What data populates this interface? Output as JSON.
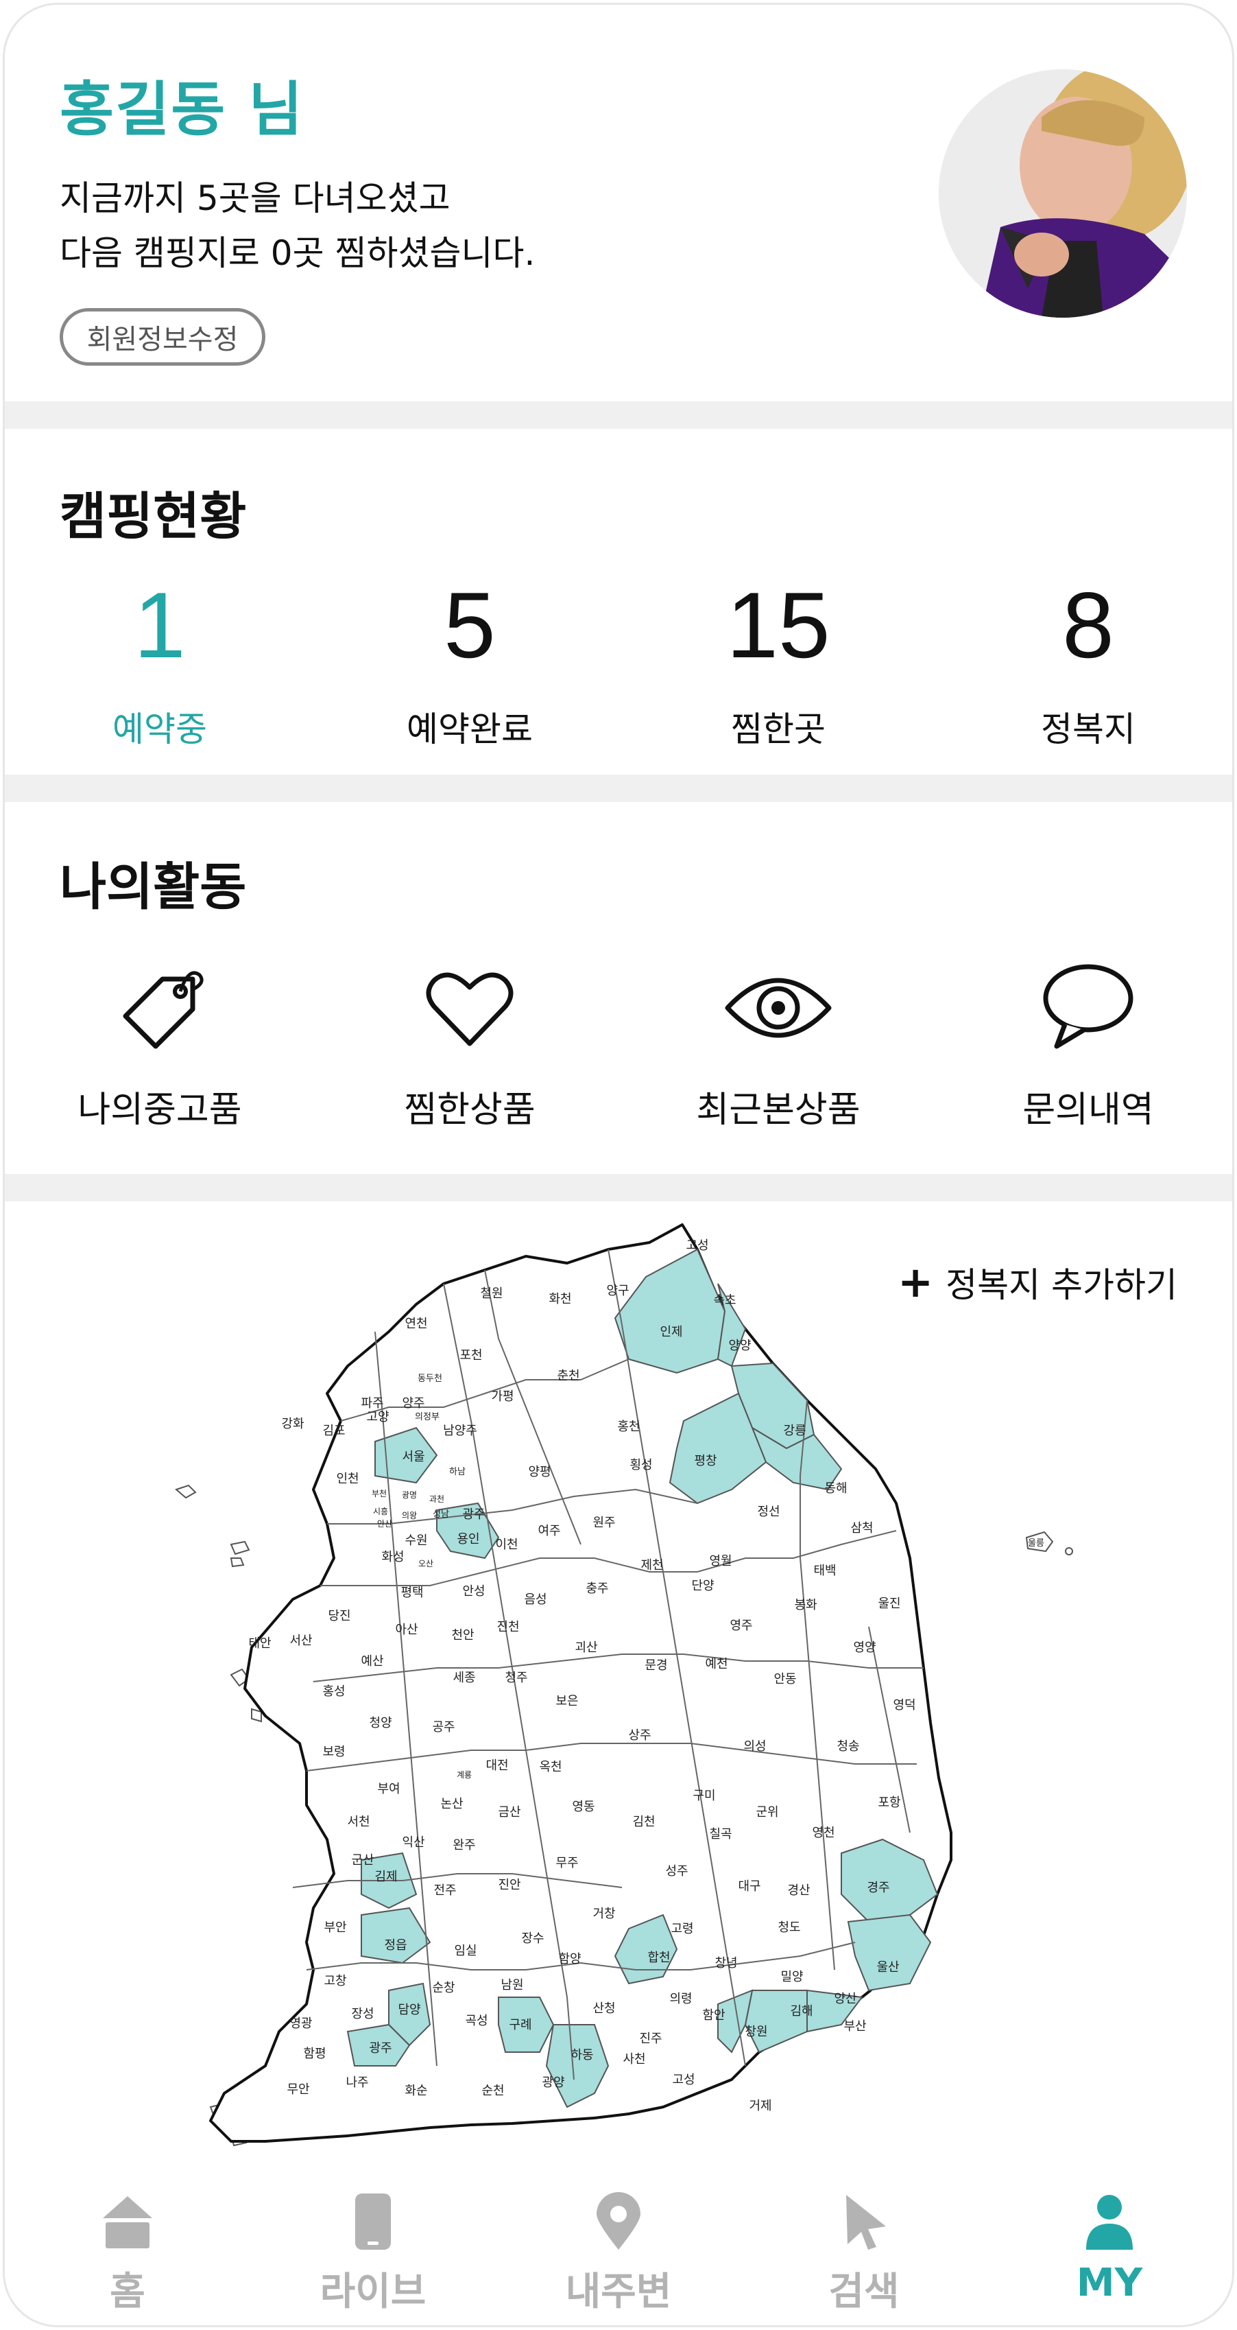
{
  "profile": {
    "name": "홍길동 님",
    "line1": "지금까지 5곳을 다녀오셨고",
    "line2": "다음 캠핑지로 0곳 찜하셨습니다.",
    "edit_button": "회원정보수정"
  },
  "camping_status": {
    "title": "캠핑현황",
    "stats": [
      {
        "value": "1",
        "label": "예약중",
        "active": true
      },
      {
        "value": "5",
        "label": "예약완료",
        "active": false
      },
      {
        "value": "15",
        "label": "찜한곳",
        "active": false
      },
      {
        "value": "8",
        "label": "정복지",
        "active": false
      }
    ]
  },
  "my_activity": {
    "title": "나의활동",
    "items": [
      {
        "label": "나의중고품",
        "icon": "tag-icon"
      },
      {
        "label": "찜한상품",
        "icon": "heart-icon"
      },
      {
        "label": "최근본상품",
        "icon": "eye-icon"
      },
      {
        "label": "문의내역",
        "icon": "chat-bubble-icon"
      }
    ]
  },
  "map": {
    "add_label": "정복지 추가하기",
    "highlight_color": "#a8dedc",
    "regions": [
      {
        "name": "고성",
        "visited": false
      },
      {
        "name": "속초",
        "visited": true
      },
      {
        "name": "인제",
        "visited": true
      },
      {
        "name": "양양",
        "visited": true
      },
      {
        "name": "철원",
        "visited": false
      },
      {
        "name": "화천",
        "visited": false
      },
      {
        "name": "양구",
        "visited": false
      },
      {
        "name": "연천",
        "visited": false
      },
      {
        "name": "포천",
        "visited": false
      },
      {
        "name": "춘천",
        "visited": false
      },
      {
        "name": "동두천",
        "visited": false
      },
      {
        "name": "가평",
        "visited": false
      },
      {
        "name": "파주",
        "visited": false
      },
      {
        "name": "양주",
        "visited": false
      },
      {
        "name": "홍천",
        "visited": false
      },
      {
        "name": "강릉",
        "visited": true
      },
      {
        "name": "강화",
        "visited": false
      },
      {
        "name": "김포",
        "visited": false
      },
      {
        "name": "고양",
        "visited": false
      },
      {
        "name": "의정부",
        "visited": false
      },
      {
        "name": "남양주",
        "visited": false
      },
      {
        "name": "서울",
        "visited": true
      },
      {
        "name": "하남",
        "visited": false
      },
      {
        "name": "양평",
        "visited": false
      },
      {
        "name": "횡성",
        "visited": false
      },
      {
        "name": "평창",
        "visited": true
      },
      {
        "name": "동해",
        "visited": true
      },
      {
        "name": "인천",
        "visited": false
      },
      {
        "name": "부천",
        "visited": false
      },
      {
        "name": "광명",
        "visited": false
      },
      {
        "name": "과천",
        "visited": false
      },
      {
        "name": "성남",
        "visited": false
      },
      {
        "name": "광주",
        "visited": false
      },
      {
        "name": "시흥",
        "visited": false
      },
      {
        "name": "안산",
        "visited": false
      },
      {
        "name": "의왕",
        "visited": false
      },
      {
        "name": "수원",
        "visited": false
      },
      {
        "name": "용인",
        "visited": true
      },
      {
        "name": "이천",
        "visited": false
      },
      {
        "name": "여주",
        "visited": false
      },
      {
        "name": "원주",
        "visited": false
      },
      {
        "name": "정선",
        "visited": false
      },
      {
        "name": "삼척",
        "visited": false
      },
      {
        "name": "울릉",
        "visited": false
      },
      {
        "name": "화성",
        "visited": false
      },
      {
        "name": "오산",
        "visited": false
      },
      {
        "name": "평택",
        "visited": false
      },
      {
        "name": "안성",
        "visited": false
      },
      {
        "name": "제천",
        "visited": false
      },
      {
        "name": "영월",
        "visited": false
      },
      {
        "name": "태백",
        "visited": false
      },
      {
        "name": "충주",
        "visited": false
      },
      {
        "name": "단양",
        "visited": false
      },
      {
        "name": "음성",
        "visited": false
      },
      {
        "name": "봉화",
        "visited": false
      },
      {
        "name": "울진",
        "visited": false
      },
      {
        "name": "당진",
        "visited": false
      },
      {
        "name": "아산",
        "visited": false
      },
      {
        "name": "천안",
        "visited": false
      },
      {
        "name": "진천",
        "visited": false
      },
      {
        "name": "영주",
        "visited": false
      },
      {
        "name": "태안",
        "visited": false
      },
      {
        "name": "서산",
        "visited": false
      },
      {
        "name": "괴산",
        "visited": false
      },
      {
        "name": "문경",
        "visited": false
      },
      {
        "name": "예천",
        "visited": false
      },
      {
        "name": "영양",
        "visited": false
      },
      {
        "name": "예산",
        "visited": false
      },
      {
        "name": "세종",
        "visited": false
      },
      {
        "name": "청주",
        "visited": false
      },
      {
        "name": "안동",
        "visited": false
      },
      {
        "name": "홍성",
        "visited": false
      },
      {
        "name": "보은",
        "visited": false
      },
      {
        "name": "영덕",
        "visited": false
      },
      {
        "name": "청양",
        "visited": false
      },
      {
        "name": "공주",
        "visited": false
      },
      {
        "name": "상주",
        "visited": false
      },
      {
        "name": "의성",
        "visited": false
      },
      {
        "name": "청송",
        "visited": false
      },
      {
        "name": "보령",
        "visited": false
      },
      {
        "name": "대전",
        "visited": false
      },
      {
        "name": "옥천",
        "visited": false
      },
      {
        "name": "계룡",
        "visited": false
      },
      {
        "name": "부여",
        "visited": false
      },
      {
        "name": "논산",
        "visited": false
      },
      {
        "name": "금산",
        "visited": false
      },
      {
        "name": "영동",
        "visited": false
      },
      {
        "name": "구미",
        "visited": false
      },
      {
        "name": "군위",
        "visited": false
      },
      {
        "name": "포항",
        "visited": false
      },
      {
        "name": "서천",
        "visited": false
      },
      {
        "name": "김천",
        "visited": false
      },
      {
        "name": "영천",
        "visited": false
      },
      {
        "name": "익산",
        "visited": false
      },
      {
        "name": "완주",
        "visited": false
      },
      {
        "name": "칠곡",
        "visited": false
      },
      {
        "name": "군산",
        "visited": false
      },
      {
        "name": "무주",
        "visited": false
      },
      {
        "name": "성주",
        "visited": false
      },
      {
        "name": "대구",
        "visited": false
      },
      {
        "name": "경산",
        "visited": false
      },
      {
        "name": "경주",
        "visited": true
      },
      {
        "name": "김제",
        "visited": true
      },
      {
        "name": "전주",
        "visited": false
      },
      {
        "name": "진안",
        "visited": false
      },
      {
        "name": "거창",
        "visited": false
      },
      {
        "name": "고령",
        "visited": false
      },
      {
        "name": "부안",
        "visited": false
      },
      {
        "name": "장수",
        "visited": false
      },
      {
        "name": "청도",
        "visited": false
      },
      {
        "name": "정읍",
        "visited": true
      },
      {
        "name": "임실",
        "visited": false
      },
      {
        "name": "함양",
        "visited": false
      },
      {
        "name": "합천",
        "visited": true
      },
      {
        "name": "창녕",
        "visited": false
      },
      {
        "name": "밀양",
        "visited": false
      },
      {
        "name": "울산",
        "visited": true
      },
      {
        "name": "고창",
        "visited": false
      },
      {
        "name": "순창",
        "visited": false
      },
      {
        "name": "남원",
        "visited": false
      },
      {
        "name": "양산",
        "visited": false
      },
      {
        "name": "영광",
        "visited": false
      },
      {
        "name": "장성",
        "visited": false
      },
      {
        "name": "담양",
        "visited": true
      },
      {
        "name": "곡성",
        "visited": false
      },
      {
        "name": "구례",
        "visited": true
      },
      {
        "name": "산청",
        "visited": false
      },
      {
        "name": "의령",
        "visited": false
      },
      {
        "name": "함안",
        "visited": false
      },
      {
        "name": "창원",
        "visited": true
      },
      {
        "name": "김해",
        "visited": true
      },
      {
        "name": "부산",
        "visited": true
      },
      {
        "name": "함평",
        "visited": false
      },
      {
        "name": "광주",
        "visited": true
      },
      {
        "name": "하동",
        "visited": true
      },
      {
        "name": "진주",
        "visited": false
      },
      {
        "name": "사천",
        "visited": false
      },
      {
        "name": "무안",
        "visited": false
      },
      {
        "name": "나주",
        "visited": false
      },
      {
        "name": "화순",
        "visited": false
      },
      {
        "name": "순천",
        "visited": false
      },
      {
        "name": "광양",
        "visited": false
      },
      {
        "name": "고성",
        "visited": false
      },
      {
        "name": "거제",
        "visited": false
      }
    ]
  },
  "bottom_nav": {
    "items": [
      {
        "label": "홈",
        "icon": "home-icon",
        "active": false
      },
      {
        "label": "라이브",
        "icon": "phone-icon",
        "active": false
      },
      {
        "label": "내주변",
        "icon": "location-pin-icon",
        "active": false
      },
      {
        "label": "검색",
        "icon": "cursor-icon",
        "active": false
      },
      {
        "label": "MY",
        "icon": "person-icon",
        "active": true
      }
    ]
  },
  "colors": {
    "accent": "#23a6a6",
    "inactive_nav": "#b3b3b3",
    "divider": "#f0f0f0"
  }
}
